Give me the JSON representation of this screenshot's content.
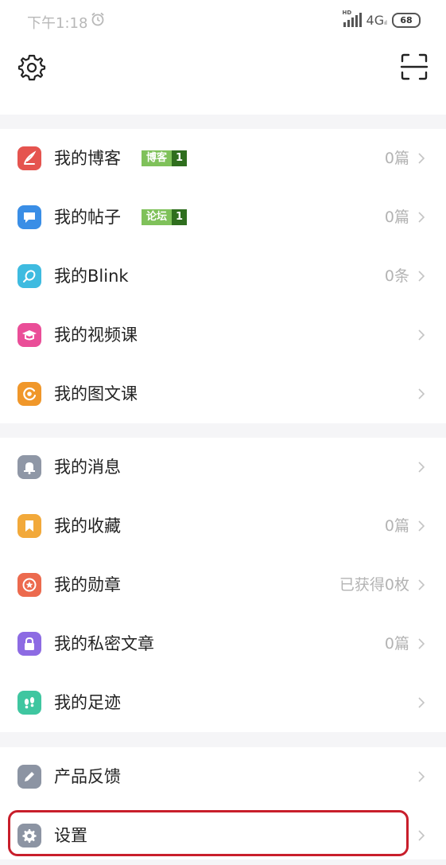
{
  "status_bar": {
    "time": "下午1:18",
    "network": "4G",
    "network_sup": "HD",
    "network_sub": "ıl",
    "battery": "68"
  },
  "top_bar": {
    "settings_icon": "gear-icon",
    "scan_icon": "scan-icon"
  },
  "groups": [
    {
      "items": [
        {
          "label": "我的博客",
          "badge_text": "博客",
          "badge_count": "1",
          "value": "0篇",
          "icon": "blog-pen-icon",
          "color": "#e5544f"
        },
        {
          "label": "我的帖子",
          "badge_text": "论坛",
          "badge_count": "1",
          "value": "0篇",
          "icon": "chat-bubble-icon",
          "color": "#3a8ee6"
        },
        {
          "label": "我的Blink",
          "value": "0条",
          "icon": "pin-icon",
          "color": "#3ebbe0"
        },
        {
          "label": "我的视频课",
          "value": "",
          "icon": "graduation-cap-icon",
          "color": "#ea4e98"
        },
        {
          "label": "我的图文课",
          "value": "",
          "icon": "target-icon",
          "color": "#f0972a"
        }
      ]
    },
    {
      "items": [
        {
          "label": "我的消息",
          "value": "",
          "icon": "bell-icon",
          "color": "#8f97a6"
        },
        {
          "label": "我的收藏",
          "value": "0篇",
          "icon": "bookmark-icon",
          "color": "#f2a93a"
        },
        {
          "label": "我的勋章",
          "value": "已获得0枚",
          "icon": "medal-icon",
          "color": "#ec6a4e"
        },
        {
          "label": "我的私密文章",
          "value": "0篇",
          "icon": "lock-icon",
          "color": "#8d6be3"
        },
        {
          "label": "我的足迹",
          "value": "",
          "icon": "footprint-icon",
          "color": "#3fc6a0"
        }
      ]
    },
    {
      "items": [
        {
          "label": "产品反馈",
          "value": "",
          "icon": "pencil-icon",
          "color": "#8c94a3"
        },
        {
          "label": "设置",
          "value": "",
          "icon": "gear-icon",
          "color": "#8c94a3"
        }
      ]
    }
  ],
  "colors": {
    "highlight": "#c81e2b",
    "badge_green": "#7fc15a",
    "badge_dark": "#2f6e1e"
  }
}
